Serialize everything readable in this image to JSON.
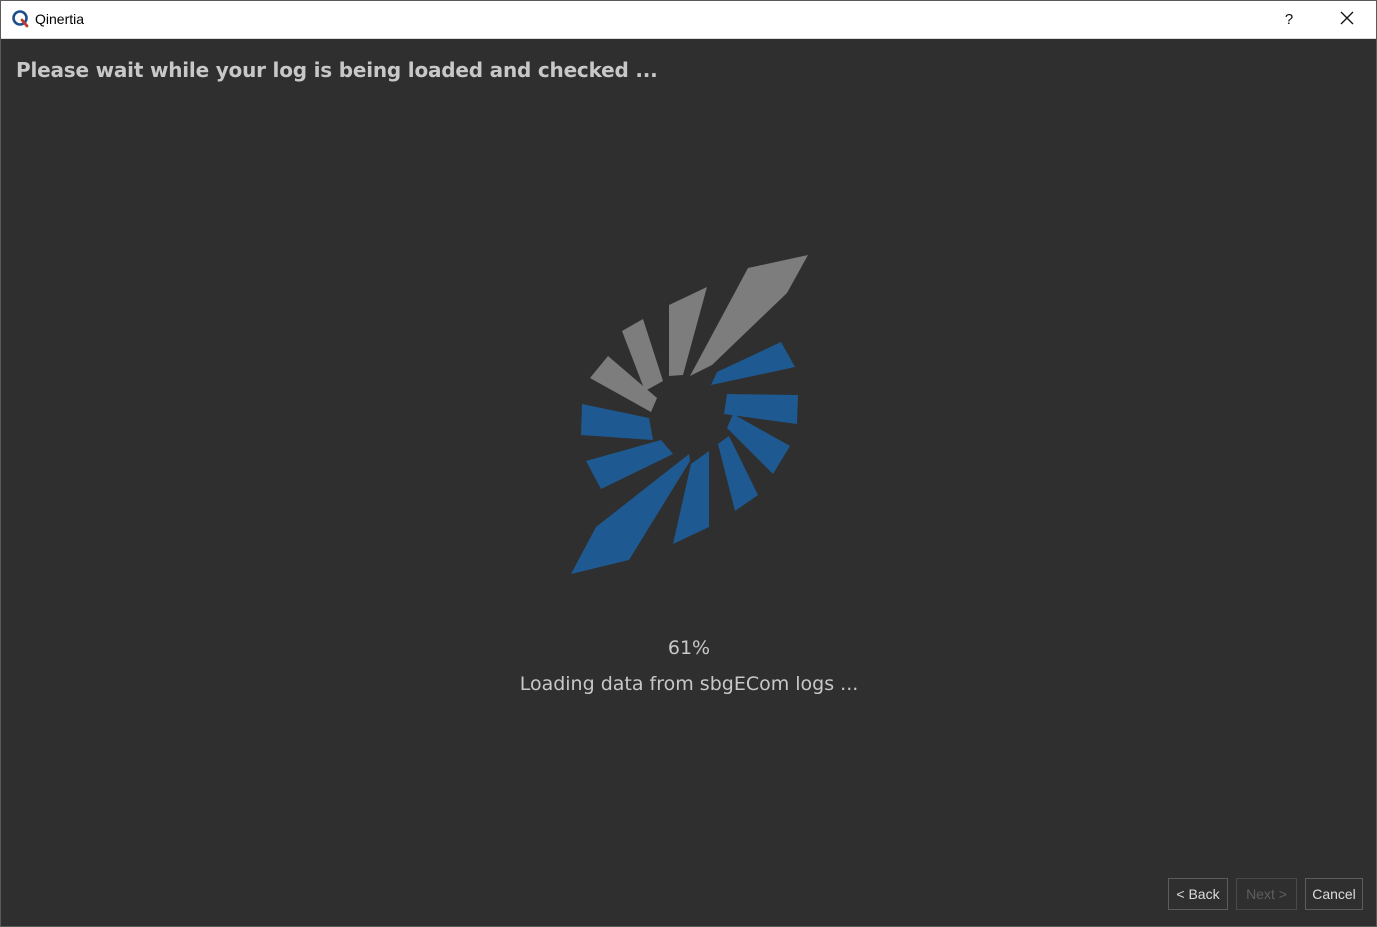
{
  "window": {
    "title": "Qinertia",
    "help_label": "?"
  },
  "wizard": {
    "heading": "Please wait while your log is being loaded and checked ...",
    "progress_percent_label": "61%",
    "progress_value": 61,
    "status": "Loading data from sbgECom logs ..."
  },
  "buttons": {
    "back": "< Back",
    "next": "Next >",
    "cancel": "Cancel"
  },
  "colors": {
    "background": "#2f2f2f",
    "spinner_active": "#1e5a91",
    "spinner_inactive": "#7d7d7d",
    "text": "#c8c8c8"
  },
  "icons": {
    "app": "qinertia-logo-icon",
    "close": "close-icon",
    "spinner": "loading-spinner-icon"
  }
}
